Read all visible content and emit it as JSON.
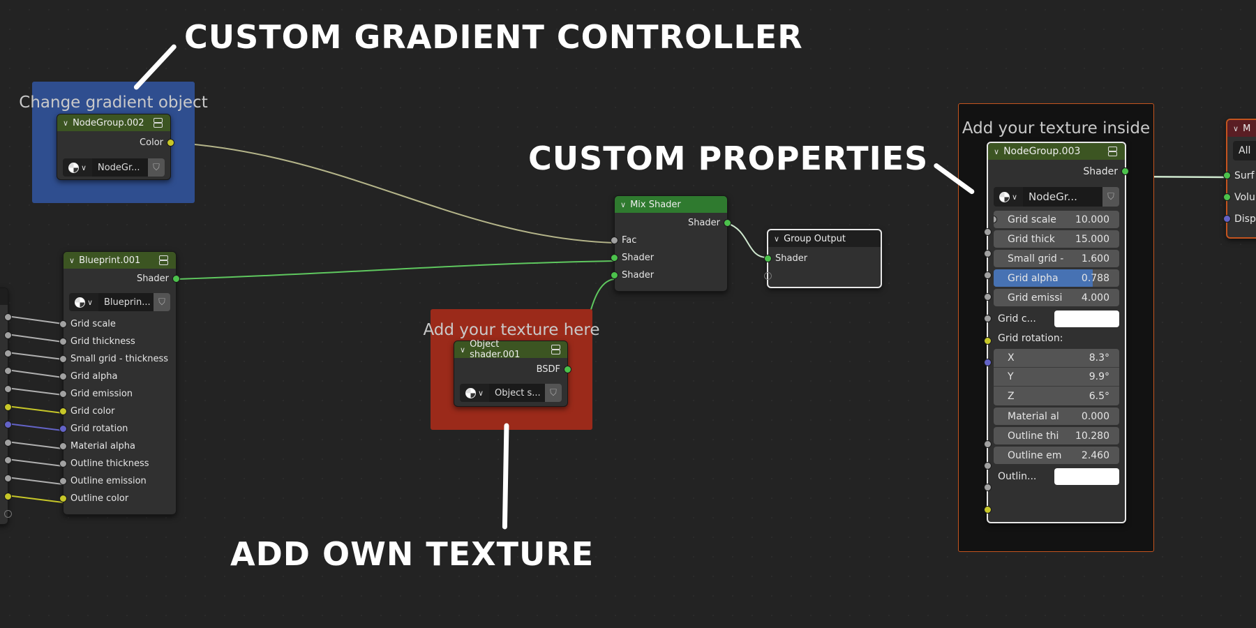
{
  "callouts": {
    "gradient": "CUSTOM GRADIENT CONTROLLER",
    "properties": "CUSTOM PROPERTIES",
    "texture": "ADD OWN TEXTURE"
  },
  "frames": {
    "blue": {
      "label": "Change gradient object",
      "color": "#2f4e8f"
    },
    "red": {
      "label": "Add your texture here",
      "color": "#9b2a1a"
    },
    "dark": {
      "label": "Add your texture inside",
      "color": "#121212",
      "border": "#c4541f"
    }
  },
  "nodes": {
    "nodegroup002": {
      "title": "NodeGroup.002",
      "output": "Color",
      "datablock": "NodeGr..."
    },
    "blueprint001": {
      "title": "Blueprint.001",
      "output": "Shader",
      "datablock": "Blueprin...",
      "inputs": [
        {
          "label": "Grid scale",
          "type": "gray"
        },
        {
          "label": "Grid thickness",
          "type": "gray"
        },
        {
          "label": "Small grid - thickness",
          "type": "gray"
        },
        {
          "label": "Grid alpha",
          "type": "gray"
        },
        {
          "label": "Grid emission",
          "type": "gray"
        },
        {
          "label": "Grid color",
          "type": "yellow"
        },
        {
          "label": "Grid rotation",
          "type": "blue"
        },
        {
          "label": "Material alpha",
          "type": "gray"
        },
        {
          "label": "Outline thickness",
          "type": "gray"
        },
        {
          "label": "Outline emission",
          "type": "gray"
        },
        {
          "label": "Outline color",
          "type": "yellow"
        }
      ]
    },
    "objectshader001": {
      "title": "Object shader.001",
      "output": "BSDF",
      "datablock": "Object s..."
    },
    "mixshader": {
      "title": "Mix Shader",
      "output": "Shader",
      "inputs": [
        "Fac",
        "Shader",
        "Shader"
      ]
    },
    "groupoutput": {
      "title": "Group Output",
      "inputs": [
        "Shader"
      ]
    },
    "nodegroup003": {
      "title": "NodeGroup.003",
      "output": "Shader",
      "datablock": "NodeGr...",
      "fields": [
        {
          "label": "Grid scale",
          "value": "10.000"
        },
        {
          "label": "Grid thick",
          "value": "15.000"
        },
        {
          "label": "Small grid -",
          "value": "1.600"
        },
        {
          "label": "Grid alpha",
          "value": "0.788",
          "fill": 0.788
        },
        {
          "label": "Grid emissi",
          "value": "4.000"
        }
      ],
      "grid_color_label": "Grid c...",
      "grid_color": "#ffffff",
      "rotation_label": "Grid rotation:",
      "rotation": [
        {
          "axis": "X",
          "value": "8.3°"
        },
        {
          "axis": "Y",
          "value": "9.9°"
        },
        {
          "axis": "Z",
          "value": "6.5°"
        }
      ],
      "fields2": [
        {
          "label": "Material al",
          "value": "0.000"
        },
        {
          "label": "Outline thi",
          "value": "10.280"
        },
        {
          "label": "Outline em",
          "value": "2.460"
        }
      ],
      "outline_color_label": "Outlin...",
      "outline_color": "#ffffff"
    },
    "materialoutput": {
      "title": "M",
      "target": "All",
      "inputs": [
        "Surf",
        "Volu",
        "Disp"
      ]
    }
  }
}
